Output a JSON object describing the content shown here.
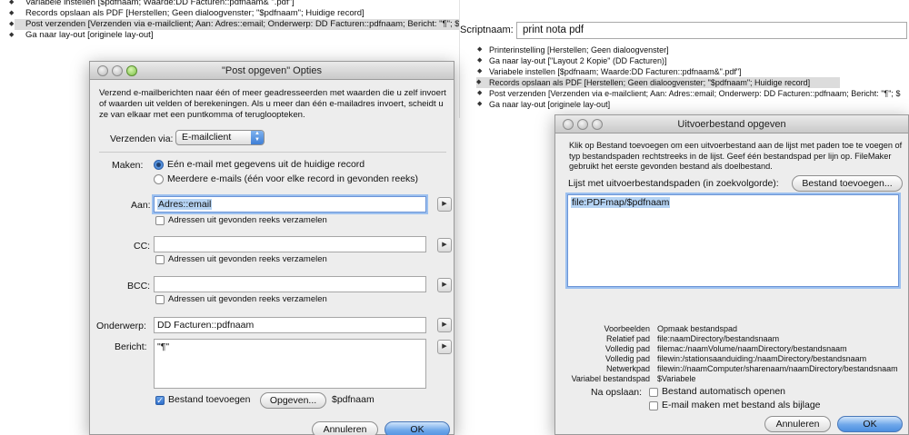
{
  "bg_left": {
    "steps": [
      {
        "text": "Variabele instellen [$pdfnaam; Waarde:DD Facturen::pdfnaam& \".pdf\"]",
        "selected": false
      },
      {
        "text": "Records opslaan als PDF [Herstellen; Geen dialoogvenster; \"$pdfnaam\"; Huidige record]",
        "selected": false
      },
      {
        "text": "Post verzenden [Verzenden via e-mailclient; Aan: Adres::email; Onderwerp: DD Facturen::pdfnaam; Bericht: \"¶\"; $",
        "selected": true
      },
      {
        "text": "Ga naar lay-out [originele lay-out]",
        "selected": false
      }
    ]
  },
  "bg_right": {
    "script_name_label": "Scriptnaam:",
    "script_name_value": "print nota pdf",
    "steps": [
      {
        "text": "Printerinstelling [Herstellen; Geen dialoogvenster]",
        "selected": false
      },
      {
        "text": "Ga naar lay-out [\"Layout 2 Kopie\" (DD Facturen)]",
        "selected": false
      },
      {
        "text": "Variabele instellen [$pdfnaam; Waarde:DD Facturen::pdfnaam&\".pdf\"]",
        "selected": false
      },
      {
        "text": "Records opslaan als PDF [Herstellen; Geen dialoogvenster; \"$pdfnaam\"; Huidige record]",
        "selected": true
      },
      {
        "text": "Post verzenden [Verzenden via e-mailclient; Aan: Adres::email; Onderwerp: DD Facturen::pdfnaam; Bericht: \"¶\"; $",
        "selected": false
      },
      {
        "text": "Ga naar lay-out [originele lay-out]",
        "selected": false
      }
    ]
  },
  "post_dialog": {
    "title": "\"Post opgeven\" Opties",
    "intro": "Verzend e-mailberichten naar één of meer geadresseerden met waarden die u zelf invoert of waarden uit velden of berekeningen. Als u meer dan één e-mailadres invoert, scheidt u ze van elkaar met een puntkomma of terugloopteken.",
    "send_via_label": "Verzenden via:",
    "send_via_value": "E-mailclient",
    "make_label": "Maken:",
    "make_option1": "Eén e-mail met gegevens uit de huidige record",
    "make_option2": "Meerdere e-mails (één voor elke record in gevonden reeks)",
    "to_label": "Aan:",
    "to_value": "Adres::email",
    "collect_label": "Adressen uit gevonden reeks verzamelen",
    "cc_label": "CC:",
    "bcc_label": "BCC:",
    "subject_label": "Onderwerp:",
    "subject_value": "DD Facturen::pdfnaam",
    "message_label": "Bericht:",
    "message_value": "\"¶\"",
    "attach_label": "Bestand toevoegen",
    "specify_button": "Opgeven...",
    "attach_value": "$pdfnaam",
    "cancel_button": "Annuleren",
    "ok_button": "OK"
  },
  "output_dialog": {
    "title": "Uitvoerbestand opgeven",
    "intro": "Klik op Bestand toevoegen om een uitvoerbestand aan de lijst met paden toe te voegen of typ bestandspaden rechtstreeks in de lijst. Geef één bestandspad per lijn op. FileMaker gebruikt het eerste gevonden bestand als doelbestand.",
    "list_label": "Lijst met uitvoerbestandspaden (in zoekvolgorde):",
    "add_file_button": "Bestand toevoegen...",
    "path_value": "file:PDFmap/$pdfnaam",
    "examples": [
      {
        "label": "Voorbeelden",
        "value": "Opmaak bestandspad"
      },
      {
        "label": "Relatief pad",
        "value": "file:naamDirectory/bestandsnaam"
      },
      {
        "label": "Volledig pad",
        "value": "filemac:/naamVolume/naamDirectory/bestandsnaam"
      },
      {
        "label": "Volledig pad",
        "value": "filewin:/stationsaanduiding:/naamDirectory/bestandsnaam"
      },
      {
        "label": "Netwerkpad",
        "value": "filewin://naamComputer/sharenaam/naamDirectory/bestandsnaam"
      },
      {
        "label": "Variabel bestandspad",
        "value": "$Variabele"
      }
    ],
    "after_save_label": "Na opslaan:",
    "auto_open_label": "Bestand automatisch openen",
    "email_attach_label": "E-mail maken met bestand als bijlage",
    "cancel_button": "Annuleren",
    "ok_button": "OK"
  }
}
